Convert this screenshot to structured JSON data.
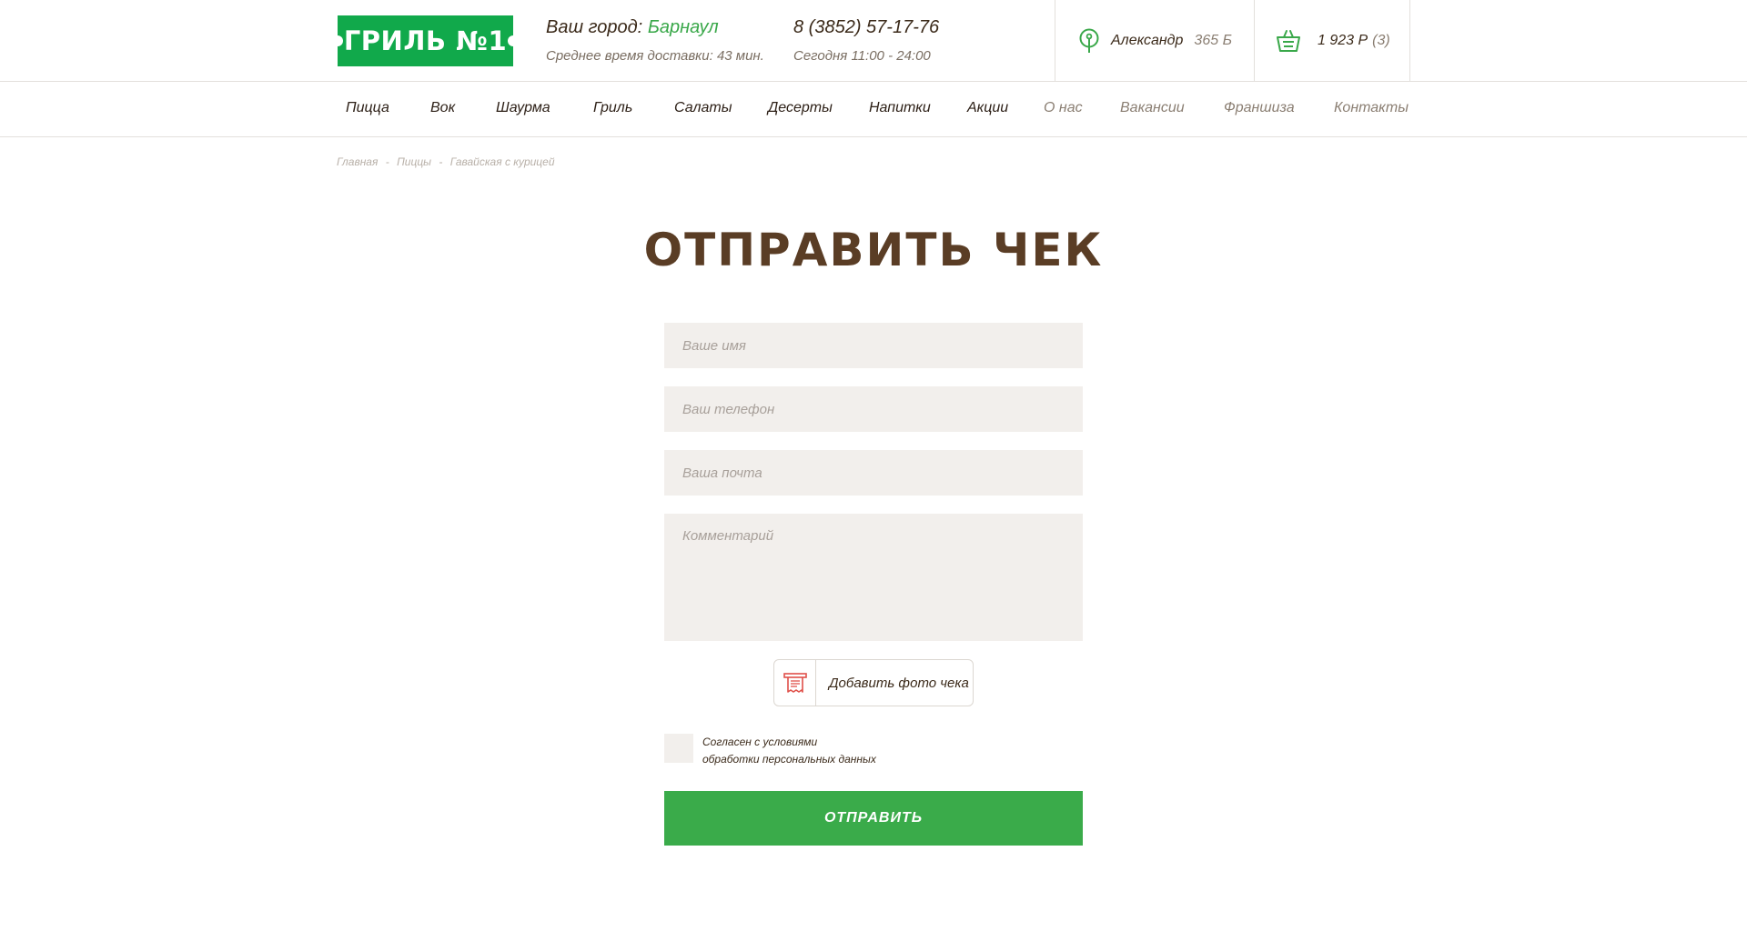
{
  "header": {
    "logo_text": "ГРИЛЬ №1",
    "city_label": "Ваш город:",
    "city_name": "Барнаул",
    "delivery_time": "Среднее время доставки: 43 мин.",
    "phone": "8 (3852) 57-17-76",
    "hours": "Сегодня 11:00 - 24:00",
    "user_name": "Александр",
    "user_points": "365 Б",
    "cart_total": "1 923 Р",
    "cart_count": "(3)",
    "icons": {
      "location": "location-pin-icon",
      "cart": "shopping-basket-icon"
    },
    "colors": {
      "brand_green": "#11a94b",
      "accent_green": "#3aa84a"
    }
  },
  "nav": {
    "main": [
      "Пицца",
      "Вок",
      "Шаурма",
      "Гриль",
      "Салаты",
      "Десерты",
      "Напитки",
      "Акции"
    ],
    "secondary": [
      "О нас",
      "Вакансии",
      "Франшиза",
      "Контакты"
    ]
  },
  "breadcrumbs": [
    "Главная",
    "Пиццы",
    "Гавайская с курицей"
  ],
  "breadcrumb_separator": "-",
  "page_title": "ОТПРАВИТЬ ЧЕК",
  "form": {
    "name_placeholder": "Ваше имя",
    "phone_placeholder": "Ваш телефон",
    "email_placeholder": "Ваша почта",
    "comment_placeholder": "Комментарий",
    "upload_label": "Добавить фото чека",
    "upload_icon": "receipt-icon",
    "agree_line1": "Согласен с условиями",
    "agree_line2": "обработки персональных данных",
    "agree_checked": false,
    "submit_label": "ОТПРАВИТЬ",
    "submit_color": "#3aab4a"
  }
}
